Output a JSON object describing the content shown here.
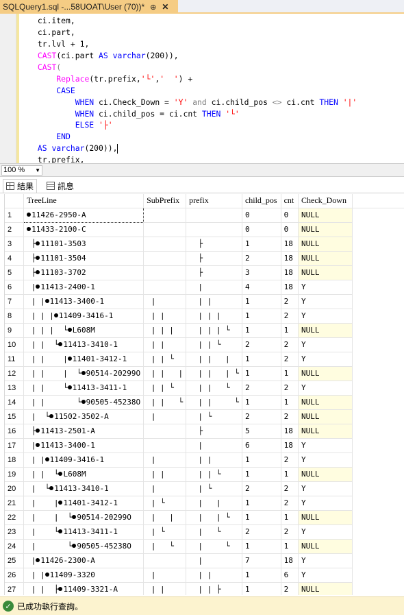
{
  "tab": {
    "title": "SQLQuery1.sql -...58UOAT\\User (70))*",
    "pin": "⊕",
    "close": "✕"
  },
  "editor": {
    "lines": [
      [
        {
          "t": "        ci.item,",
          "c": "id"
        }
      ],
      [
        {
          "t": "        ci.part,",
          "c": "id"
        }
      ],
      [
        {
          "t": "        tr.lvl + 1,",
          "c": "id"
        }
      ],
      [
        {
          "t": "        ",
          "c": "id"
        },
        {
          "t": "CAST",
          "c": "fn"
        },
        {
          "t": "(ci.part ",
          "c": "id"
        },
        {
          "t": "AS",
          "c": "kw"
        },
        {
          "t": " ",
          "c": "id"
        },
        {
          "t": "varchar",
          "c": "kw"
        },
        {
          "t": "(200)),",
          "c": "id"
        }
      ],
      [
        {
          "t": "        ",
          "c": "id"
        },
        {
          "t": "CAST",
          "c": "fn"
        },
        {
          "t": "(",
          "c": "op"
        }
      ],
      [
        {
          "t": "            ",
          "c": "id"
        },
        {
          "t": "Replace",
          "c": "fn"
        },
        {
          "t": "(tr.prefix,",
          "c": "id"
        },
        {
          "t": "'└'",
          "c": "str"
        },
        {
          "t": ",",
          "c": "id"
        },
        {
          "t": "'  '",
          "c": "str"
        },
        {
          "t": ") +",
          "c": "id"
        }
      ],
      [
        {
          "t": "            ",
          "c": "id"
        },
        {
          "t": "CASE",
          "c": "kw"
        }
      ],
      [
        {
          "t": "                ",
          "c": "id"
        },
        {
          "t": "WHEN",
          "c": "kw"
        },
        {
          "t": " ci.Check_Down = ",
          "c": "id"
        },
        {
          "t": "'Y'",
          "c": "str"
        },
        {
          "t": " ",
          "c": "id"
        },
        {
          "t": "and",
          "c": "op"
        },
        {
          "t": " ci.child_pos ",
          "c": "id"
        },
        {
          "t": "<>",
          "c": "op"
        },
        {
          "t": " ci.cnt ",
          "c": "id"
        },
        {
          "t": "THEN",
          "c": "kw"
        },
        {
          "t": " ",
          "c": "id"
        },
        {
          "t": "'|'",
          "c": "str"
        }
      ],
      [
        {
          "t": "                ",
          "c": "id"
        },
        {
          "t": "WHEN",
          "c": "kw"
        },
        {
          "t": " ci.child_pos = ci.cnt ",
          "c": "id"
        },
        {
          "t": "THEN",
          "c": "kw"
        },
        {
          "t": " ",
          "c": "id"
        },
        {
          "t": "'└'",
          "c": "str"
        }
      ],
      [
        {
          "t": "                ",
          "c": "id"
        },
        {
          "t": "ELSE",
          "c": "kw"
        },
        {
          "t": " ",
          "c": "id"
        },
        {
          "t": "'├'",
          "c": "str"
        }
      ],
      [
        {
          "t": "            ",
          "c": "id"
        },
        {
          "t": "END",
          "c": "kw"
        }
      ],
      [
        {
          "t": "        ",
          "c": "id"
        },
        {
          "t": "AS",
          "c": "kw"
        },
        {
          "t": " ",
          "c": "id"
        },
        {
          "t": "varchar",
          "c": "kw"
        },
        {
          "t": "(200)),",
          "c": "id"
        }
      ],
      [
        {
          "t": "        tr.prefix,",
          "c": "id"
        }
      ]
    ]
  },
  "zoom": {
    "value": "100 %"
  },
  "results_tabs": {
    "results": "結果",
    "messages": "訊息"
  },
  "grid": {
    "columns": [
      "",
      "TreeLine",
      "SubPrefix",
      "prefix",
      "child_pos",
      "cnt",
      "Check_Down"
    ],
    "rows": [
      [
        "1",
        "",
        "11426-2950-A",
        "",
        "",
        "0",
        "0",
        "NULL"
      ],
      [
        "2",
        "",
        "11433-2100-C",
        "",
        "",
        "0",
        "0",
        "NULL"
      ],
      [
        "3",
        " ├",
        "11101-3503",
        "",
        "  ├",
        "1",
        "18",
        "NULL"
      ],
      [
        "4",
        " ├",
        "11101-3504",
        "",
        "  ├",
        "2",
        "18",
        "NULL"
      ],
      [
        "5",
        " ├",
        "11103-3702",
        "",
        "  ├",
        "3",
        "18",
        "NULL"
      ],
      [
        "6",
        " |",
        "11413-2400-1",
        "",
        "  |",
        "4",
        "18",
        "Y"
      ],
      [
        "7",
        " | |",
        "11413-3400-1",
        " |",
        "  | |",
        "1",
        "2",
        "Y"
      ],
      [
        "8",
        " | | |",
        "11409-3416-1",
        " | |",
        "  | | |",
        "1",
        "2",
        "Y"
      ],
      [
        "9",
        " | | |  └",
        "L608M",
        " | | |",
        "  | | | └",
        "1",
        "1",
        "NULL"
      ],
      [
        "10",
        " | |  └",
        "11413-3410-1",
        " | |",
        "  | | └",
        "2",
        "2",
        "Y"
      ],
      [
        "11",
        " | |    |",
        "11401-3412-1",
        " | | └",
        "  | |   |",
        "1",
        "2",
        "Y"
      ],
      [
        "12",
        " | |    |  └",
        "90514-20299O",
        " | |   |",
        "  | |   | └",
        "1",
        "1",
        "NULL"
      ],
      [
        "13",
        " | |    └",
        "11413-3411-1",
        " | | └",
        "  | |   └",
        "2",
        "2",
        "Y"
      ],
      [
        "14",
        " | |       └",
        "90505-45238O",
        " | |   └",
        "  | |     └",
        "1",
        "1",
        "NULL"
      ],
      [
        "15",
        " |  └",
        "11502-3502-A",
        " |",
        "  | └",
        "2",
        "2",
        "NULL"
      ],
      [
        "16",
        " ├",
        "11413-2501-A",
        "",
        "  ├",
        "5",
        "18",
        "NULL"
      ],
      [
        "17",
        " |",
        "11413-3400-1",
        "",
        "  |",
        "6",
        "18",
        "Y"
      ],
      [
        "18",
        " | |",
        "11409-3416-1",
        " |",
        "  | |",
        "1",
        "2",
        "Y"
      ],
      [
        "19",
        " | |  └",
        "L608M",
        " | |",
        "  | | └",
        "1",
        "1",
        "NULL"
      ],
      [
        "20",
        " |  └",
        "11413-3410-1",
        " |",
        "  | └",
        "2",
        "2",
        "Y"
      ],
      [
        "21",
        " |    |",
        "11401-3412-1",
        " | └",
        "  |   |",
        "1",
        "2",
        "Y"
      ],
      [
        "22",
        " |    |  └",
        "90514-20299O",
        " |   |",
        "  |   | └",
        "1",
        "1",
        "NULL"
      ],
      [
        "23",
        " |    └",
        "11413-3411-1",
        " | └",
        "  |   └",
        "2",
        "2",
        "Y"
      ],
      [
        "24",
        " |       └",
        "90505-45238O",
        " |   └",
        "  |     └",
        "1",
        "1",
        "NULL"
      ],
      [
        "25",
        " |",
        "11426-2300-A",
        "",
        "  |",
        "7",
        "18",
        "Y"
      ],
      [
        "26",
        " | |",
        "11409-3320",
        " |",
        "  | |",
        "1",
        "6",
        "Y"
      ],
      [
        "27",
        " | |  ├",
        "11409-3321-A",
        " | |",
        "  | | ├",
        "1",
        "2",
        "NULL"
      ]
    ]
  },
  "status": {
    "message": "已成功執行查詢。",
    "icon": "check-icon"
  }
}
